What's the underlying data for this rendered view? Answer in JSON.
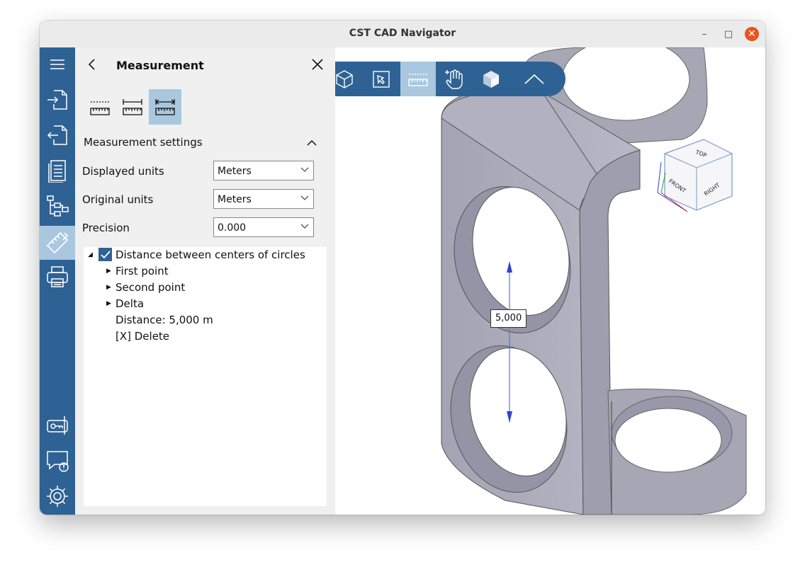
{
  "window": {
    "title": "CST CAD Navigator",
    "minimize": "–",
    "maximize": "□",
    "close": "✕"
  },
  "colors": {
    "sidebar": "#2f6294",
    "active": "#a9c8e0",
    "panel": "#f0f0f0",
    "close": "#e95420"
  },
  "sidebar": {
    "items": [
      {
        "name": "menu-icon"
      },
      {
        "name": "import-icon"
      },
      {
        "name": "export-icon"
      },
      {
        "name": "document-icon"
      },
      {
        "name": "tree-structure-icon"
      },
      {
        "name": "measurement-icon",
        "active": true
      },
      {
        "name": "print-icon"
      },
      {
        "name": "license-key-icon"
      },
      {
        "name": "feedback-icon"
      },
      {
        "name": "settings-gear-icon"
      }
    ]
  },
  "panel": {
    "title": "Measurement",
    "modes": [
      "point-measure-icon",
      "edge-measure-icon",
      "distance-measure-icon"
    ],
    "section_title": "Measurement settings",
    "settings": [
      {
        "label": "Displayed units",
        "value": "Meters"
      },
      {
        "label": "Original units",
        "value": "Meters"
      },
      {
        "label": "Precision",
        "value": "0.000"
      }
    ],
    "tree": {
      "root": "Distance between centers of circles",
      "children": [
        "First point",
        "Second point",
        "Delta"
      ],
      "distance": "Distance: 5,000 m",
      "delete": "[X] Delete"
    }
  },
  "viewport": {
    "toolbar": [
      "view-cube-icon",
      "select-icon",
      "measure-ruler-icon",
      "pan-hand-icon",
      "shaded-box-icon",
      "collapse-chevron-icon"
    ],
    "measurement_label": "5,000",
    "view_cube": {
      "top": "TOP",
      "front": "FRONT",
      "right": "RIGHT"
    }
  }
}
